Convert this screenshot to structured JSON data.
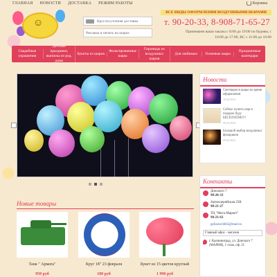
{
  "topnav": [
    "ГЛАВНАЯ",
    "НОВОСТИ",
    "ДОСТАВКА",
    "РЕЖИМ РАБОТЫ"
  ],
  "cart_label": "Корзина",
  "header": {
    "delivery_label": "Круглосуточная доставка",
    "ad_label": "Реклама и печать на шарах",
    "slogan": "ВСЕ ВИДЫ ОФОРМЛЕНИЯ ВОЗДУШНЫМИ ШАРАМИ",
    "phone": "т. 90-20-33, 8-908-71-65-27",
    "hours": "Принимаем ваши заказы с 8:00 до 19:00 по будням, с 10:00 до 17:00, ВС с 11:00 до 16:00"
  },
  "menu": [
    "Свадебные украшения",
    "Детские праздники, выписка из род. дома",
    "Букеты из шаров",
    "Фольгированные шары",
    "Гирлянды из воздушных шаров",
    "Для любимых",
    "Гелиевые шары",
    "Праздничные календари"
  ],
  "news": {
    "title": "Новости",
    "items": [
      {
        "text": "Светящиеся шары во время оформления",
        "date": "10.04.2016",
        "color": "#2c1c63"
      },
      {
        "text": "Сейчас купить шар в подарок буду БЕСПЛАТНО!!!",
        "date": "09.04.2016",
        "color": "#f0e6c8"
      },
      {
        "text": "Большой выбор воздушных фонариков",
        "date": "09.04.2016",
        "color": "#2a1208"
      }
    ]
  },
  "contacts": {
    "title": "Контакты",
    "rows": [
      {
        "line1": "Донского 7",
        "line2": "90-20-33"
      },
      {
        "line1": "Артиллерийская 25В",
        "line2": "90-21-27"
      },
      {
        "line1": "ТЦ \"Мега-Маркет\"",
        "line2": "90-21-63"
      }
    ],
    "email": "gelionwild63@mail.ru",
    "shop_select": "Главный офис - магазин",
    "address": "г. Калининград, ул. Донского 7 (МАРИЯ), 1 этаж, оф. 21"
  },
  "new_products": {
    "title": "Новые товары",
    "items": [
      {
        "name": "Танк \" Армата\"",
        "price": "950 руб",
        "color": "#3a8b3a"
      },
      {
        "name": "Круг 18\" 23 февраля",
        "price": "180 руб",
        "color": "#2c5fb8"
      },
      {
        "name": "Букет из 15 цветов круглый",
        "price": "1 990 руб",
        "color": "#e23b58"
      }
    ]
  }
}
